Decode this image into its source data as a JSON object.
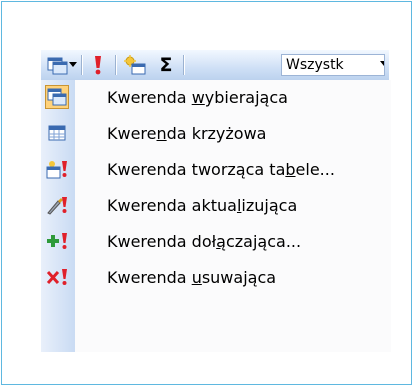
{
  "toolbar": {
    "query_type_button": "query-type",
    "run_icon": "exclamation-icon",
    "show_table_icon": "show-table-icon",
    "totals_symbol": "Σ",
    "topvalues_value": "Wszystk"
  },
  "menu": {
    "items": [
      {
        "pre": "Kwerenda ",
        "acc": "w",
        "post": "ybierająca",
        "icon": "select-query-icon"
      },
      {
        "pre": "Kwere",
        "acc": "n",
        "post": "da krzyżowa",
        "icon": "crosstab-query-icon"
      },
      {
        "pre": "Kwerenda tworząca ta",
        "acc": "b",
        "post": "ele...",
        "icon": "make-table-query-icon"
      },
      {
        "pre": "Kwerenda aktua",
        "acc": "l",
        "post": "izująca",
        "icon": "update-query-icon"
      },
      {
        "pre": "Kwerenda doł",
        "acc": "ą",
        "post": "czająca...",
        "icon": "append-query-icon"
      },
      {
        "pre": "Kwerenda ",
        "acc": "u",
        "post": "suwająca",
        "icon": "delete-query-icon"
      }
    ]
  },
  "colors": {
    "frame": "#5fb8e0",
    "highlight": "#ffd27a",
    "toolbar": "#cfe0f6"
  }
}
